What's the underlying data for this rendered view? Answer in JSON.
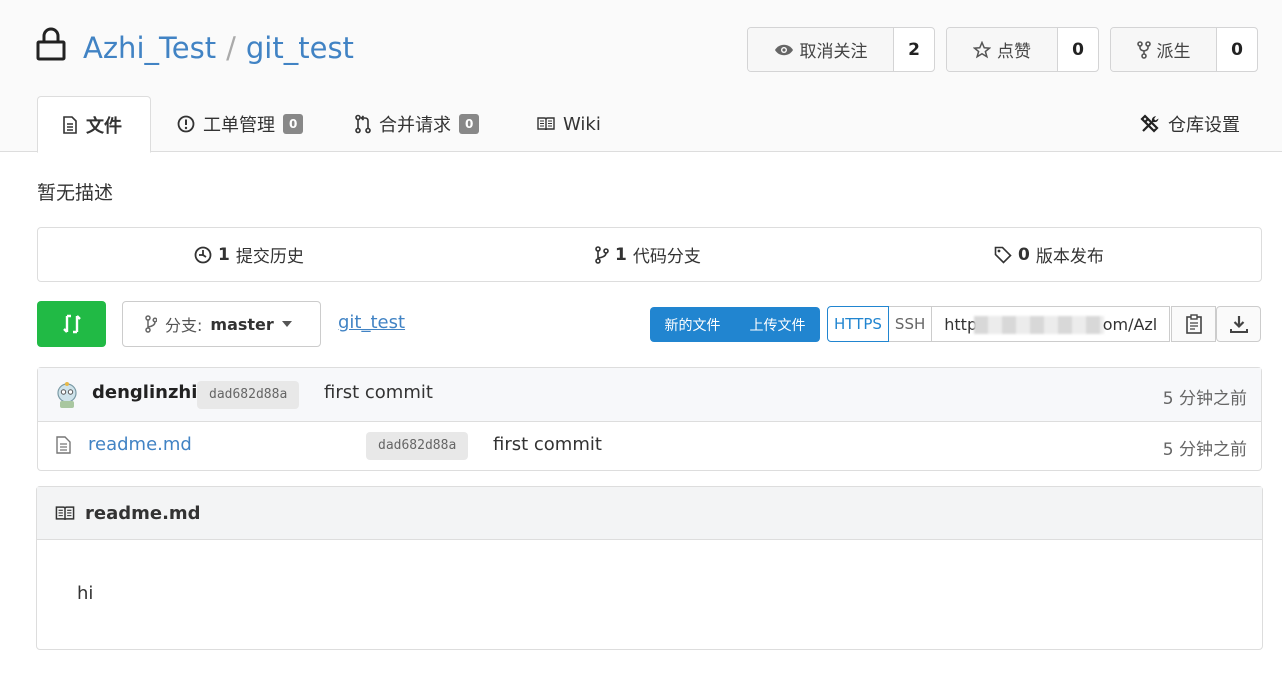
{
  "repo": {
    "owner": "Azhi_Test",
    "separator": "/",
    "name": "git_test"
  },
  "actions": {
    "watch": {
      "label": "取消关注",
      "count": "2",
      "icon": "eye-icon"
    },
    "star": {
      "label": "点赞",
      "count": "0",
      "icon": "star-icon"
    },
    "fork": {
      "label": "派生",
      "count": "0",
      "icon": "fork-icon"
    }
  },
  "tabs": [
    {
      "label": "文件",
      "icon": "file-text-icon",
      "active": true
    },
    {
      "label": "工单管理",
      "badge": "0",
      "icon": "issue-icon"
    },
    {
      "label": "合并请求",
      "badge": "0",
      "icon": "pull-request-icon"
    },
    {
      "label": "Wiki",
      "icon": "book-icon"
    },
    {
      "label": "仓库设置",
      "icon": "tools-icon"
    }
  ],
  "description": "暂无描述",
  "stats": {
    "commits": {
      "count": "1",
      "label": "提交历史"
    },
    "branches": {
      "count": "1",
      "label": "代码分支"
    },
    "releases": {
      "count": "0",
      "label": "版本发布"
    }
  },
  "toolbar": {
    "branch_prefix": "分支:",
    "branch": "master",
    "breadcrumb": "git_test",
    "new_file": "新的文件",
    "upload_file": "上传文件",
    "https": "HTTPS",
    "ssh": "SSH",
    "url_start": "http",
    "url_end": "om/Azl"
  },
  "latest_commit": {
    "author": "denglinzhi",
    "sha": "dad682d88a",
    "message": "first commit",
    "time": "5 分钟之前"
  },
  "files": [
    {
      "name": "readme.md",
      "sha": "dad682d88a",
      "message": "first commit",
      "time": "5 分钟之前"
    }
  ],
  "readme": {
    "title": "readme.md",
    "content": "hi"
  },
  "colors": {
    "link": "#4183c4",
    "primary": "#2185d0",
    "green": "#21ba45"
  }
}
